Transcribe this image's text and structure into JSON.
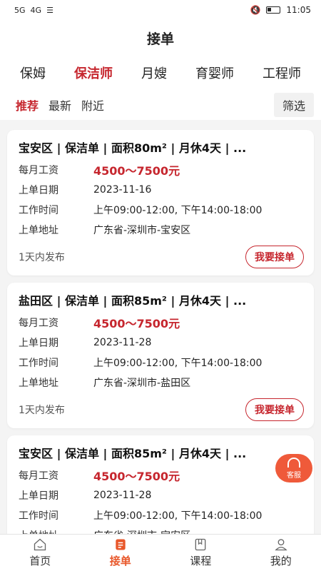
{
  "status": {
    "signal1": "5G",
    "signal2": "4G",
    "time": "11:05"
  },
  "header": {
    "title": "接单"
  },
  "categories": [
    {
      "label": "保姆",
      "active": false
    },
    {
      "label": "保洁师",
      "active": true
    },
    {
      "label": "月嫂",
      "active": false
    },
    {
      "label": "育婴师",
      "active": false
    },
    {
      "label": "工程师",
      "active": false
    }
  ],
  "filters": {
    "tabs": [
      "推荐",
      "最新",
      "附近"
    ],
    "button": "筛选"
  },
  "labels": {
    "salary": "每月工资",
    "date": "上单日期",
    "hours": "工作时间",
    "address": "上单地址"
  },
  "jobs": [
    {
      "title": "宝安区 | 保洁单 | 面积80m² | 月休4天 | ...",
      "salary": "4500～7500元",
      "date": "2023-11-16",
      "hours": "上午09:00-12:00, 下午14:00-18:00",
      "address": "广东省-深圳市-宝安区",
      "posted": "1天内发布",
      "button": "我要接单"
    },
    {
      "title": "盐田区 | 保洁单 | 面积85m² | 月休4天 | ...",
      "salary": "4500～7500元",
      "date": "2023-11-28",
      "hours": "上午09:00-12:00, 下午14:00-18:00",
      "address": "广东省-深圳市-盐田区",
      "posted": "1天内发布",
      "button": "我要接单"
    },
    {
      "title": "宝安区 | 保洁单 | 面积85m² | 月休4天 | ...",
      "salary": "4500～7500元",
      "date": "2023-11-28",
      "hours": "上午09:00-12:00, 下午14:00-18:00",
      "address": "广东省-深圳市-宝安区",
      "posted": "",
      "button": ""
    }
  ],
  "service": {
    "label": "客服"
  },
  "nav": [
    {
      "label": "首页",
      "icon": "home-icon"
    },
    {
      "label": "接单",
      "icon": "orders-icon"
    },
    {
      "label": "课程",
      "icon": "course-icon"
    },
    {
      "label": "我的",
      "icon": "profile-icon"
    }
  ],
  "colors": {
    "accent": "#c6262e",
    "nav_active": "#e8572a",
    "service": "#ef5a3a"
  }
}
